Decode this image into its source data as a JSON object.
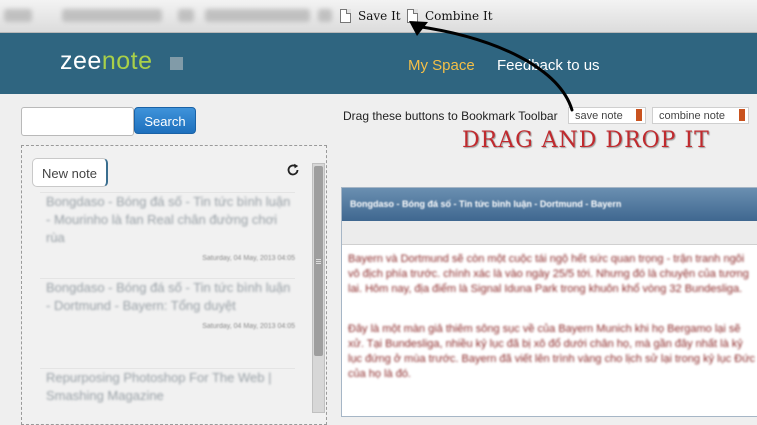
{
  "browser": {
    "bookmarks": [
      {
        "label": "Save It",
        "icon": "page-icon"
      },
      {
        "label": "Combine It",
        "icon": "page-icon"
      }
    ]
  },
  "header": {
    "logo": {
      "part1": "zee",
      "part2": "note"
    },
    "nav": [
      "My Space",
      "Feedback to us"
    ],
    "active_nav": "My Space",
    "colors": {
      "bar": "#2f6580",
      "active": "#f4bf47"
    }
  },
  "search": {
    "button_label": "Search",
    "value": ""
  },
  "notes": {
    "new_note_label": "New note",
    "items": [
      {
        "title": "Bongdaso - Bóng đá số - Tin tức bình luận - Mourinho là fan Real chân đường chơi rùa",
        "date": "Saturday, 04 May, 2013 04:05"
      },
      {
        "title": "Bongdaso - Bóng đá số - Tin tức bình luận - Dortmund - Bayern: Tổng duyệt",
        "date": "Saturday, 04 May, 2013 04:05"
      },
      {
        "title": "Repurposing Photoshop For The Web | Smashing Magazine",
        "date": ""
      }
    ]
  },
  "bookmarklet": {
    "hint": "Drag these buttons to Bookmark Toolbar",
    "buttons": [
      "save note",
      "combine note"
    ],
    "callout": "DRAG AND DROP IT"
  },
  "preview": {
    "title": "Bongdaso - Bóng đá số - Tin tức bình luận - Dortmund - Bayern",
    "paragraphs": [
      "Bayern và Dortmund sẽ còn một cuộc tái ngộ hết sức quan trọng - trận tranh ngôi vô địch phía trước. chính xác là vào ngày 25/5 tới. Nhưng đó là chuyện của tương lai. Hôm nay, địa điểm là Signal Iduna Park trong khuôn khổ vòng 32 Bundesliga.",
      "Đây là một màn giả thiêm sông sục về của Bayern Munich khi họ Bergamo lại sẽ xử. Tại Bundesliga, nhiều kỷ lục đã bị xô đổ dưới chân họ, mà gần đây nhất là kỷ lục đứng ở mùa trước. Bayern đã viết lên trình vàng cho lịch sử lại trong kỷ lục Đức của họ là đó."
    ]
  }
}
